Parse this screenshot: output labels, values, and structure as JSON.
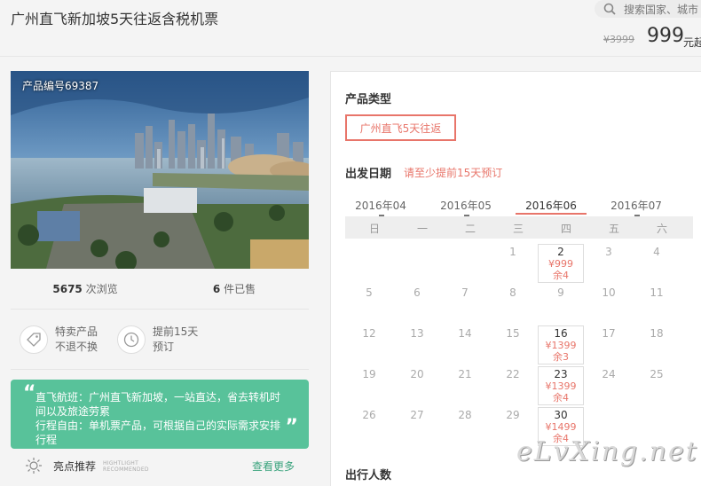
{
  "header": {
    "title": "广州直飞新加坡5天往返含税机票",
    "search_placeholder": "搜索国家、城市",
    "old_price": "¥3999",
    "price": "999",
    "price_unit": "元起"
  },
  "product": {
    "code_label": "产品编号69387",
    "views_count": "5675",
    "views_label": "次浏览",
    "sold_count": "6",
    "sold_label": "件已售",
    "features": [
      {
        "icon": "tag-icon",
        "line1": "特卖产品",
        "line2": "不退不换"
      },
      {
        "icon": "clock-icon",
        "line1": "提前15天",
        "line2": "预订"
      }
    ],
    "highlights": [
      "直飞航班：广州直飞新加坡，一站直达，省去转机时",
      "间以及旅途劳累",
      "行程自由：单机票产品，可根据自己的实际需求安排",
      "行程"
    ],
    "rec_title": "亮点推荐",
    "rec_en_1": "HIGHTLIGHT",
    "rec_en_2": "RECOMMENDED",
    "rec_more": "查看更多"
  },
  "booking": {
    "type_title": "产品类型",
    "type_option": "广州直飞5天往返",
    "date_title": "出发日期",
    "date_note": "请至少提前15天预订",
    "months": [
      "2016年04",
      "2016年05",
      "2016年06",
      "2016年07"
    ],
    "active_month": 2,
    "weekdays": [
      "日",
      "一",
      "二",
      "三",
      "四",
      "五",
      "六"
    ],
    "days": [
      {
        "d": "1",
        "col": 3,
        "row": 0
      },
      {
        "d": "3",
        "col": 5,
        "row": 0
      },
      {
        "d": "4",
        "col": 6,
        "row": 0
      },
      {
        "d": "5",
        "col": 0,
        "row": 1
      },
      {
        "d": "6",
        "col": 1,
        "row": 1
      },
      {
        "d": "7",
        "col": 2,
        "row": 1
      },
      {
        "d": "8",
        "col": 3,
        "row": 1
      },
      {
        "d": "9",
        "col": 4,
        "row": 1
      },
      {
        "d": "10",
        "col": 5,
        "row": 1
      },
      {
        "d": "11",
        "col": 6,
        "row": 1
      },
      {
        "d": "12",
        "col": 0,
        "row": 2
      },
      {
        "d": "13",
        "col": 1,
        "row": 2
      },
      {
        "d": "14",
        "col": 2,
        "row": 2
      },
      {
        "d": "15",
        "col": 3,
        "row": 2
      },
      {
        "d": "17",
        "col": 5,
        "row": 2
      },
      {
        "d": "18",
        "col": 6,
        "row": 2
      },
      {
        "d": "19",
        "col": 0,
        "row": 3
      },
      {
        "d": "20",
        "col": 1,
        "row": 3
      },
      {
        "d": "21",
        "col": 2,
        "row": 3
      },
      {
        "d": "22",
        "col": 3,
        "row": 3
      },
      {
        "d": "24",
        "col": 5,
        "row": 3
      },
      {
        "d": "25",
        "col": 6,
        "row": 3
      },
      {
        "d": "26",
        "col": 0,
        "row": 4
      },
      {
        "d": "27",
        "col": 1,
        "row": 4
      },
      {
        "d": "28",
        "col": 2,
        "row": 4
      },
      {
        "d": "29",
        "col": 3,
        "row": 4
      }
    ],
    "available": [
      {
        "d": "2",
        "price": "¥999",
        "remain": "余4",
        "col": 4,
        "row": 0
      },
      {
        "d": "16",
        "price": "¥1399",
        "remain": "余3",
        "col": 4,
        "row": 2
      },
      {
        "d": "23",
        "price": "¥1399",
        "remain": "余4",
        "col": 4,
        "row": 3
      },
      {
        "d": "30",
        "price": "¥1499",
        "remain": "余4",
        "col": 4,
        "row": 4
      }
    ],
    "people_title": "出行人数"
  },
  "watermark": "eLvXing.net",
  "colors": {
    "accent": "#e8756a",
    "green": "#58c29a"
  }
}
